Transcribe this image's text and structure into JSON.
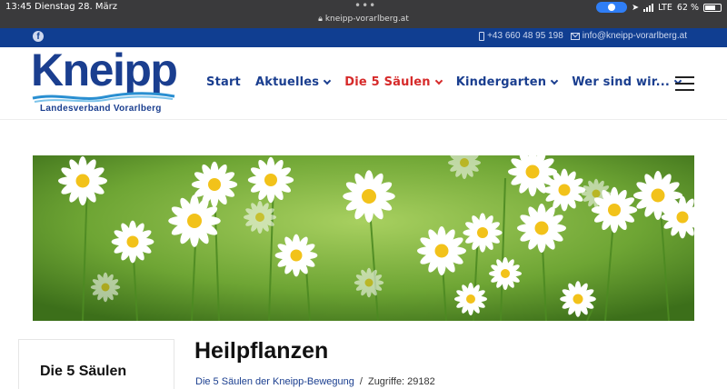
{
  "status_bar": {
    "time": "13:45",
    "date": "Dienstag 28. März",
    "url": "kneipp-vorarlberg.at",
    "carrier": "LTE",
    "battery": "62 %"
  },
  "top_bar": {
    "phone": "+43 660 48 95 198",
    "email": "info@kneipp-vorarlberg.at"
  },
  "logo": {
    "wordmark": "Kneipp",
    "subtitle": "Landesverband Vorarlberg"
  },
  "nav": {
    "items": [
      {
        "label": "Start"
      },
      {
        "label": "Aktuelles"
      },
      {
        "label": "Die 5 Säulen"
      },
      {
        "label": "Kindergarten"
      },
      {
        "label": "Wer sind wir..."
      }
    ]
  },
  "sidebar": {
    "title": "Die 5 Säulen"
  },
  "article": {
    "title": "Heilpflanzen",
    "category": "Die 5 Säulen der Kneipp-Bewegung",
    "separator": "/",
    "hits": "Zugriffe: 29182"
  },
  "colors": {
    "brand_blue": "#1a3e8f",
    "top_bar": "#103e91",
    "active_nav": "#d62a2a"
  }
}
